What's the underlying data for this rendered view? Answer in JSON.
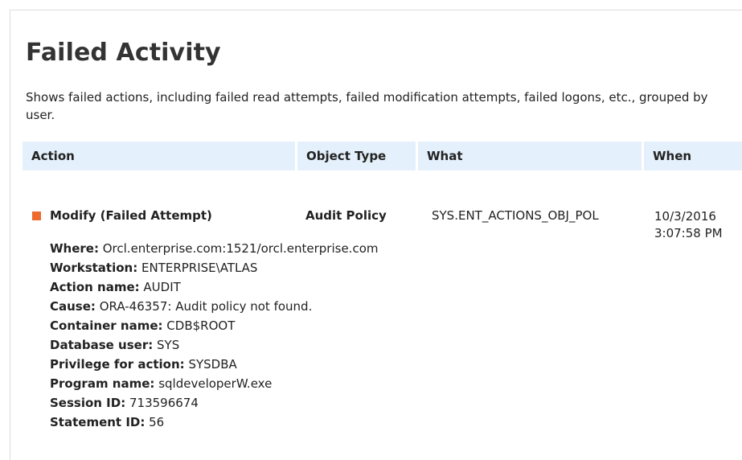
{
  "report": {
    "title": "Failed Activity",
    "description": "Shows failed actions, including failed read attempts, failed modification attempts, failed logons, etc., grouped by user."
  },
  "table": {
    "columns": {
      "action": "Action",
      "object_type": "Object Type",
      "what": "What",
      "when": "When"
    },
    "row": {
      "status_color": "#ed6b2f",
      "action": "Modify (Failed Attempt)",
      "object_type": "Audit Policy",
      "what": "SYS.ENT_ACTIONS_OBJ_POL",
      "when_date": "10/3/2016",
      "when_time": "3:07:58 PM",
      "details": [
        {
          "label": "Where:",
          "value": "Orcl.enterprise.com:1521/orcl.enterprise.com"
        },
        {
          "label": "Workstation:",
          "value": "ENTERPRISE\\ATLAS"
        },
        {
          "label": "Action name:",
          "value": "AUDIT"
        },
        {
          "label": "Cause:",
          "value": "ORA-46357: Audit policy not found."
        },
        {
          "label": "Container name:",
          "value": "CDB$ROOT"
        },
        {
          "label": "Database user:",
          "value": "SYS"
        },
        {
          "label": "Privilege for action:",
          "value": "SYSDBA"
        },
        {
          "label": "Program name:",
          "value": "sqldeveloperW.exe"
        },
        {
          "label": "Session ID:",
          "value": "713596674"
        },
        {
          "label": "Statement ID:",
          "value": "56"
        }
      ]
    }
  }
}
